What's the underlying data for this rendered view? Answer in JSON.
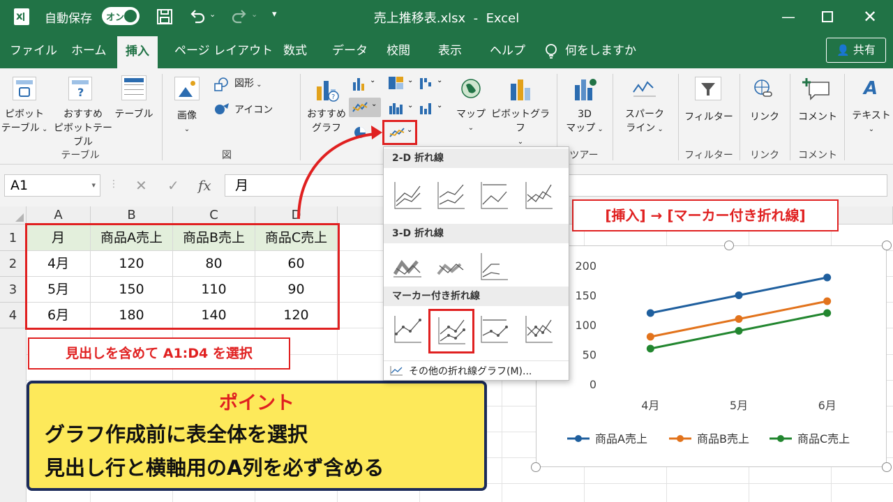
{
  "titlebar": {
    "autosave_label": "自動保存",
    "autosave_state": "オン",
    "filename": "売上推移表.xlsx",
    "separator": "-",
    "app_name": "Excel"
  },
  "tabs": [
    "ファイル",
    "ホーム",
    "挿入",
    "ページ レイアウト",
    "数式",
    "データ",
    "校閲",
    "表示",
    "ヘルプ"
  ],
  "tell_me": "何をしますか",
  "share": "共有",
  "ribbon": {
    "pivot_l1": "ピボット",
    "pivot_l2": "テーブル",
    "rec_pivot_l1": "おすすめ",
    "rec_pivot_l2": "ピボットテーブル",
    "table": "テーブル",
    "group_table": "テーブル",
    "image": "画像",
    "shapes": "図形",
    "icons": "アイコン",
    "group_illust": "図",
    "rec_chart_l1": "おすすめ",
    "rec_chart_l2": "グラフ",
    "map": "マップ",
    "pivot_chart": "ピボットグラフ",
    "map3d_l1": "3D",
    "map3d_l2": "マップ",
    "group_tour": "ツアー",
    "sparkline_l1": "スパーク",
    "sparkline_l2": "ライン",
    "filter": "フィルター",
    "group_filter": "フィルター",
    "link": "リンク",
    "group_link": "リンク",
    "comment": "コメント",
    "group_comment": "コメント",
    "text": "テキスト"
  },
  "formula_bar": {
    "name_box": "A1",
    "fx": "fx",
    "value": "月"
  },
  "columns": [
    "A",
    "B",
    "C",
    "D"
  ],
  "rows": [
    "1",
    "2",
    "3",
    "4"
  ],
  "table": [
    [
      "月",
      "商品A売上",
      "商品B売上",
      "商品C売上"
    ],
    [
      "4月",
      "120",
      "80",
      "60"
    ],
    [
      "5月",
      "150",
      "110",
      "90"
    ],
    [
      "6月",
      "180",
      "140",
      "120"
    ]
  ],
  "dropdown": {
    "sec_2d": "2-D 折れ線",
    "sec_3d": "3-D 折れ線",
    "sec_marker": "マーカー付き折れ線",
    "more": "その他の折れ線グラフ(M)..."
  },
  "callouts": {
    "selection": "見出しを含めて A1:D4 を選択",
    "insert_path": "[挿入] → [マーカー付き折れ線]",
    "point_title": "ポイント",
    "point_line1": "グラフ作成前に表全体を選択",
    "point_line2": "見出し行と横軸用のA列を必ず含める"
  },
  "colors": {
    "excel_green": "#217346",
    "series_a": "#1f5f9e",
    "series_b": "#e2731c",
    "series_c": "#22862f",
    "callout_red": "#e02020"
  },
  "chart_data": {
    "type": "line",
    "categories": [
      "4月",
      "5月",
      "6月"
    ],
    "series": [
      {
        "name": "商品A売上",
        "values": [
          120,
          150,
          180
        ]
      },
      {
        "name": "商品B売上",
        "values": [
          80,
          110,
          140
        ]
      },
      {
        "name": "商品C売上",
        "values": [
          60,
          90,
          120
        ]
      }
    ],
    "ylim": [
      0,
      200
    ],
    "yticks": [
      "0",
      "50",
      "100",
      "150",
      "200"
    ],
    "markers": true,
    "legend": "bottom"
  }
}
